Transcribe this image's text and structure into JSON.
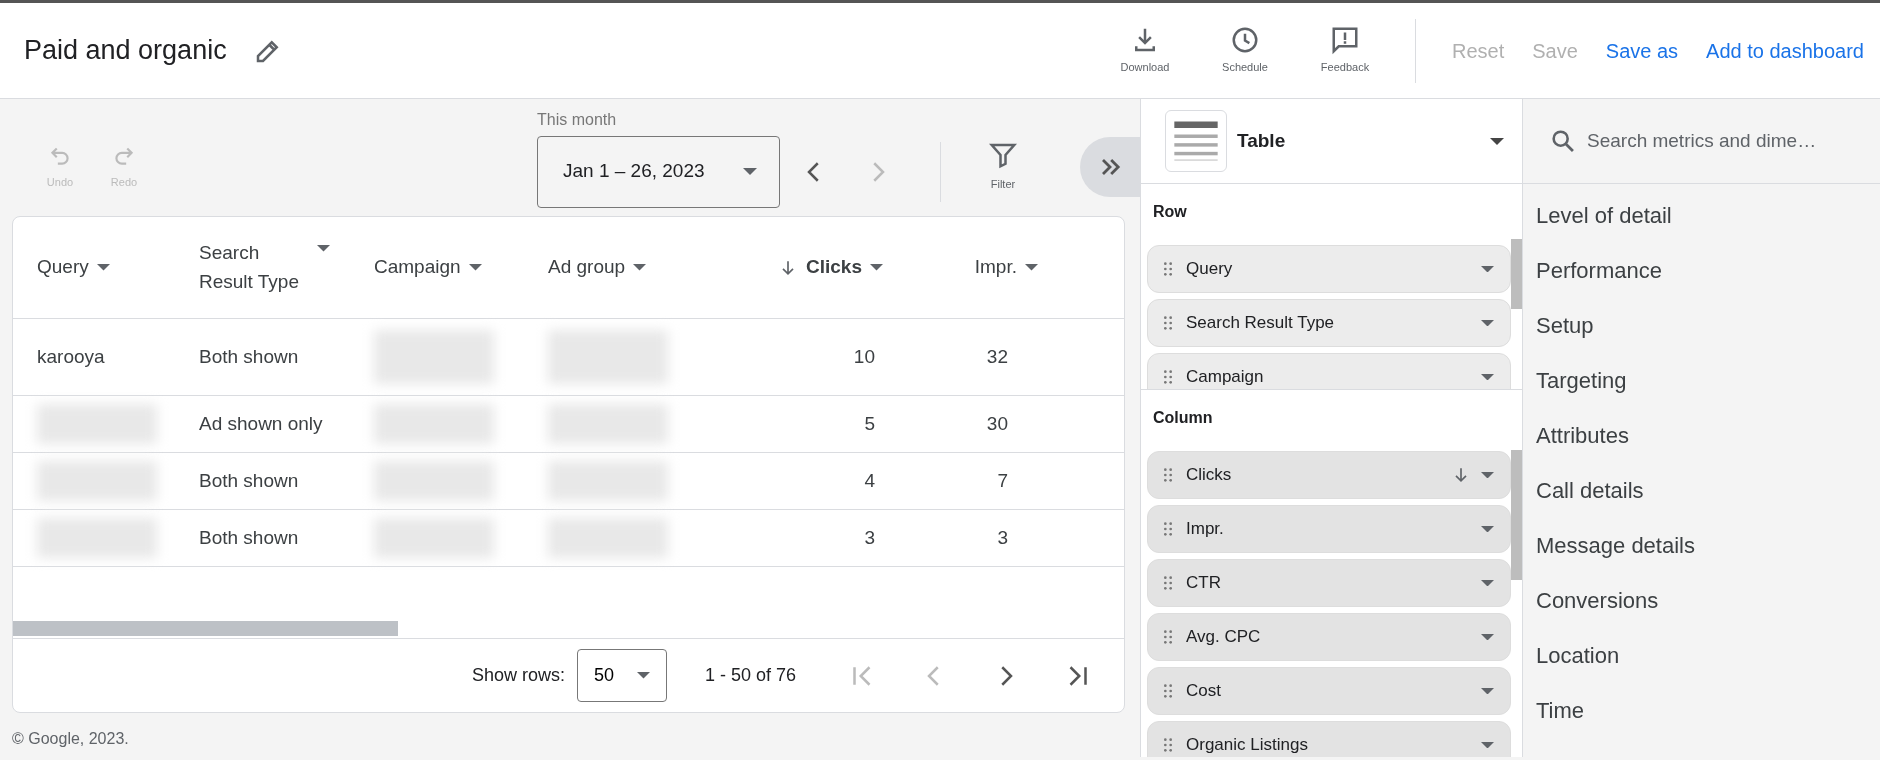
{
  "header": {
    "title": "Paid and organic",
    "tools": [
      {
        "kind": "download",
        "label": "Download"
      },
      {
        "kind": "schedule",
        "label": "Schedule"
      },
      {
        "kind": "feedback",
        "label": "Feedback"
      }
    ],
    "actions": [
      {
        "label": "Reset",
        "disabled": true
      },
      {
        "label": "Save",
        "disabled": true
      },
      {
        "label": "Save as",
        "disabled": false
      },
      {
        "label": "Add to dashboard",
        "disabled": false
      }
    ]
  },
  "toolbar": {
    "history": [
      {
        "kind": "undo",
        "label": "Undo",
        "disabled": true
      },
      {
        "kind": "redo",
        "label": "Redo",
        "disabled": true
      }
    ],
    "date_range": {
      "caption": "This month",
      "value": "Jan 1 – 26, 2023"
    },
    "prev_disabled": false,
    "next_disabled": true,
    "filter": {
      "label": "Filter"
    }
  },
  "table": {
    "columns": [
      {
        "label": "Query",
        "sorted": false,
        "kind": "dimension"
      },
      {
        "label": "Search Result Type",
        "sorted": false,
        "kind": "dimension"
      },
      {
        "label": "Campaign",
        "sorted": false,
        "kind": "dimension"
      },
      {
        "label": "Ad group",
        "sorted": false,
        "kind": "dimension"
      },
      {
        "label": "Clicks",
        "sorted": true,
        "kind": "metric"
      },
      {
        "label": "Impr.",
        "sorted": false,
        "kind": "metric"
      }
    ],
    "rows": [
      [
        {
          "kind": "text",
          "text": "karooya"
        },
        {
          "kind": "text",
          "text": "Both shown"
        },
        {
          "kind": "blurred"
        },
        {
          "kind": "blurred"
        },
        {
          "kind": "text",
          "text": "10"
        },
        {
          "kind": "text",
          "text": "32"
        }
      ],
      [
        {
          "kind": "blurred"
        },
        {
          "kind": "text",
          "text": "Ad shown only"
        },
        {
          "kind": "blurred"
        },
        {
          "kind": "blurred"
        },
        {
          "kind": "text",
          "text": "5"
        },
        {
          "kind": "text",
          "text": "30"
        }
      ],
      [
        {
          "kind": "blurred"
        },
        {
          "kind": "text",
          "text": "Both shown"
        },
        {
          "kind": "blurred"
        },
        {
          "kind": "blurred"
        },
        {
          "kind": "text",
          "text": "4"
        },
        {
          "kind": "text",
          "text": "7"
        }
      ],
      [
        {
          "kind": "blurred"
        },
        {
          "kind": "text",
          "text": "Both shown"
        },
        {
          "kind": "blurred"
        },
        {
          "kind": "blurred"
        },
        {
          "kind": "text",
          "text": "3"
        },
        {
          "kind": "text",
          "text": "3"
        }
      ]
    ],
    "pagination": {
      "show_rows_label": "Show rows:",
      "rows_value": "50",
      "range": "1 - 50 of 76",
      "buttons": [
        {
          "kind": "first",
          "disabled": true
        },
        {
          "kind": "prev",
          "disabled": true
        },
        {
          "kind": "next",
          "disabled": false
        },
        {
          "kind": "last",
          "disabled": false
        }
      ]
    }
  },
  "footer": "© Google, 2023.",
  "editor": {
    "chart_type": "Table",
    "row_title": "Row",
    "row_fields": [
      {
        "label": "Query",
        "sorted": false
      },
      {
        "label": "Search Result Type",
        "sorted": false
      },
      {
        "label": "Campaign",
        "sorted": false
      }
    ],
    "column_title": "Column",
    "column_fields": [
      {
        "label": "Clicks",
        "sorted": true
      },
      {
        "label": "Impr.",
        "sorted": false
      },
      {
        "label": "CTR",
        "sorted": false
      },
      {
        "label": "Avg. CPC",
        "sorted": false
      },
      {
        "label": "Cost",
        "sorted": false
      },
      {
        "label": "Organic Listings",
        "sorted": false
      }
    ]
  },
  "catalog": {
    "search_placeholder": "Search metrics and dime…",
    "categories": [
      "Level of detail",
      "Performance",
      "Setup",
      "Targeting",
      "Attributes",
      "Call details",
      "Message details",
      "Conversions",
      "Location",
      "Time"
    ]
  }
}
